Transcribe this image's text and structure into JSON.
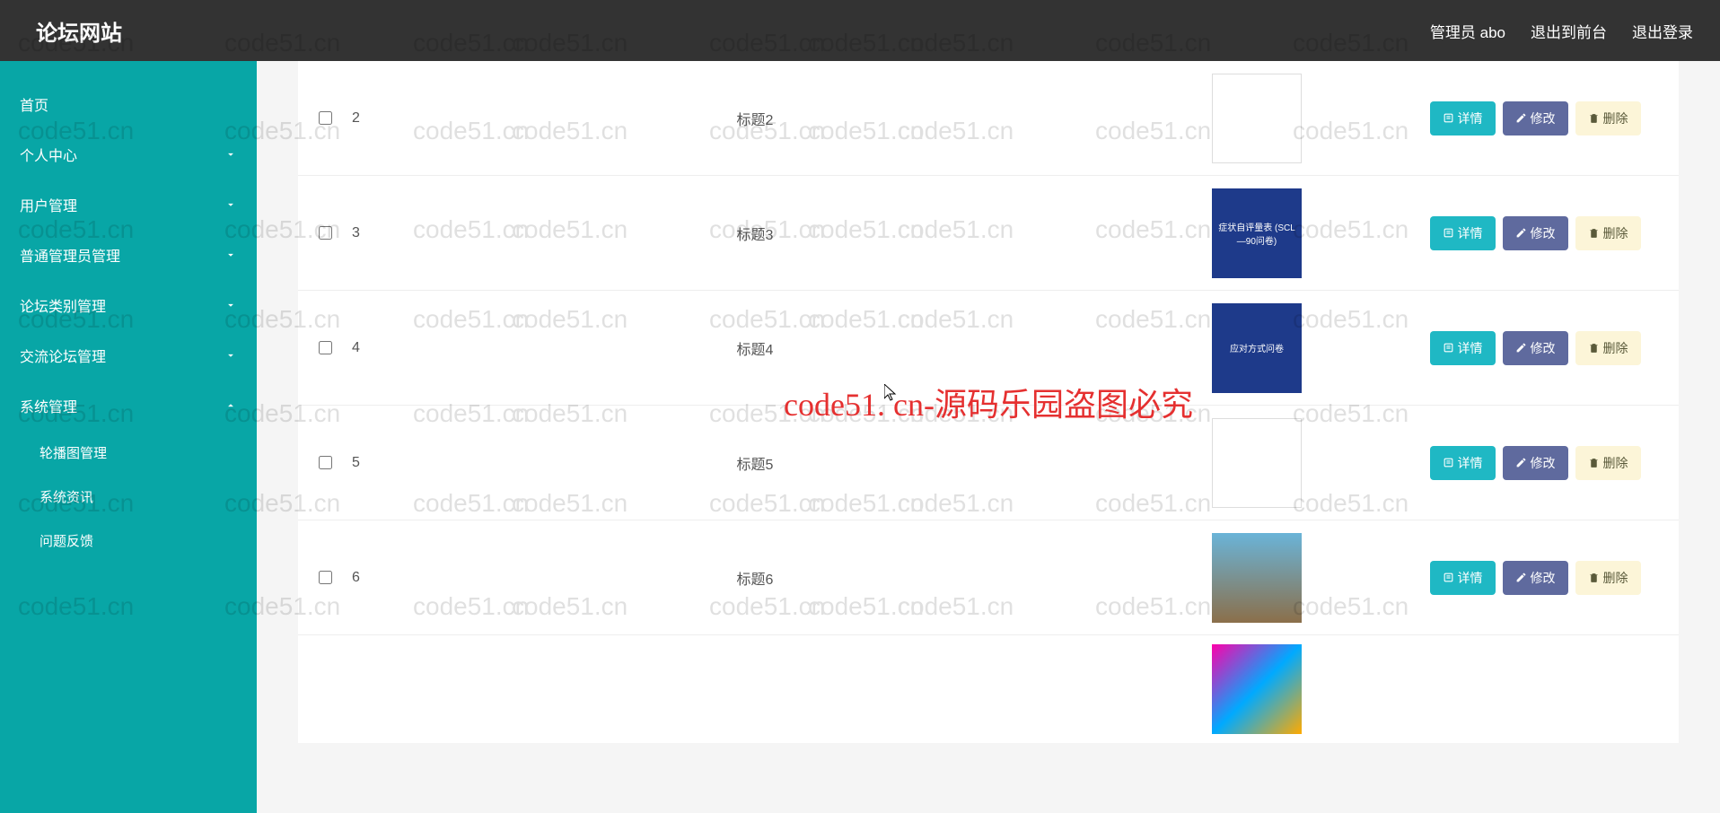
{
  "header": {
    "brand": "论坛网站",
    "admin_label": "管理员 abo",
    "exit_frontend": "退出到前台",
    "logout": "退出登录"
  },
  "sidebar": {
    "home": "首页",
    "personal": "个人中心",
    "user_mgmt": "用户管理",
    "admin_mgmt": "普通管理员管理",
    "category_mgmt": "论坛类别管理",
    "forum_mgmt": "交流论坛管理",
    "system_mgmt": "系统管理",
    "carousel_mgmt": "轮播图管理",
    "system_info": "系统资讯",
    "feedback": "问题反馈"
  },
  "buttons": {
    "detail": "详情",
    "edit": "修改",
    "delete": "删除"
  },
  "rows": [
    {
      "id": "2",
      "title": "标题2",
      "thumb_class": "t2",
      "thumb_text": ""
    },
    {
      "id": "3",
      "title": "标题3",
      "thumb_class": "t3",
      "thumb_text": "症状自评量表 (SCL—90问卷)"
    },
    {
      "id": "4",
      "title": "标题4",
      "thumb_class": "t4",
      "thumb_text": "应对方式问卷"
    },
    {
      "id": "5",
      "title": "标题5",
      "thumb_class": "t5",
      "thumb_text": ""
    },
    {
      "id": "6",
      "title": "标题6",
      "thumb_class": "t6",
      "thumb_text": ""
    },
    {
      "id": "",
      "title": "",
      "thumb_class": "t7",
      "thumb_text": ""
    }
  ],
  "watermark_center": "code51. cn-源码乐园盗图必究",
  "watermark_bg": "code51.cn"
}
